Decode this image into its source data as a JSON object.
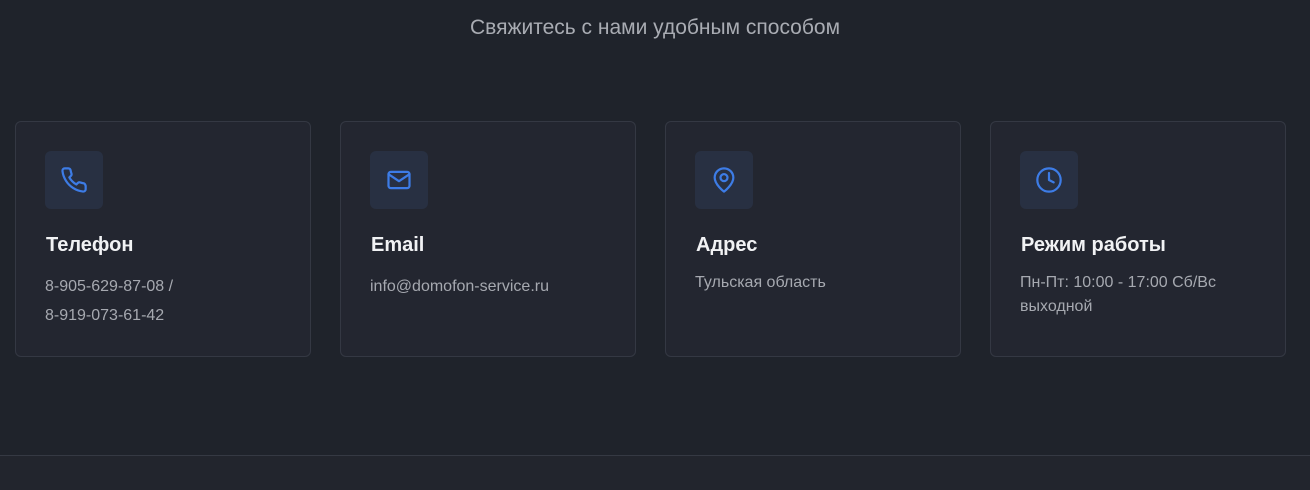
{
  "header": {
    "subtitle": "Свяжитесь с нами удобным способом"
  },
  "cards": [
    {
      "icon": "phone-icon",
      "title": "Телефон",
      "lines": [
        "8-905-629-87-08 /",
        "8-919-073-61-42"
      ]
    },
    {
      "icon": "mail-icon",
      "title": "Email",
      "lines": [
        "info@domofon-service.ru"
      ]
    },
    {
      "icon": "map-pin-icon",
      "title": "Адрес",
      "lines": [
        "Тульская область"
      ]
    },
    {
      "icon": "clock-icon",
      "title": "Режим работы",
      "lines": [
        "Пн-Пт: 10:00 - 17:00 Сб/Вс выходной"
      ]
    }
  ],
  "colors": {
    "background": "#1f232b",
    "card": "#232630",
    "accent": "#3d7ce6"
  }
}
